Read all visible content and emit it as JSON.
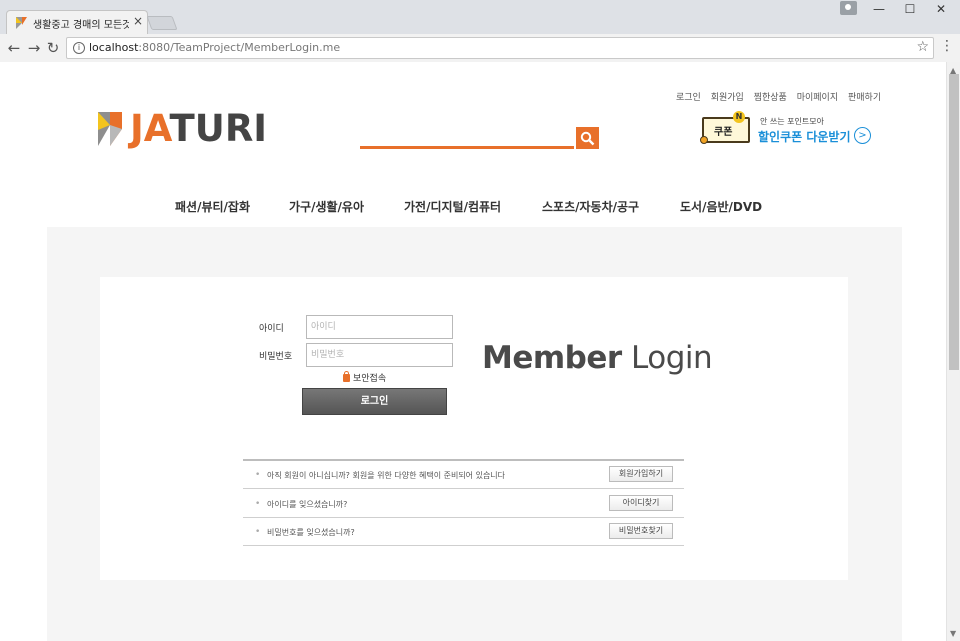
{
  "browser": {
    "tab_title": "생활중고 경매의 모든것",
    "tab_close": "×",
    "url_host": "localhost",
    "url_rest": ":8080/TeamProject/MemberLogin.me",
    "back": "←",
    "forward": "→",
    "reload": "↻",
    "info": "i",
    "star": "☆",
    "menu": "⋮",
    "minimize": "—",
    "maximize": "☐",
    "close": "✕"
  },
  "header": {
    "logo_prefix": "JA",
    "logo_suffix": "TURI",
    "util_links": [
      "로그인",
      "회원가입",
      "찜한상품",
      "마이페이지",
      "판매하기"
    ],
    "coupon": {
      "ticket": "쿠폰",
      "badge": "N",
      "small_text": "안 쓰는 포인트모아",
      "big_text": "할인쿠폰 다운받기",
      "arrow": ">"
    }
  },
  "gnb": [
    "패션/뷰티/잡화",
    "가구/생활/유아",
    "가전/디지털/컴퓨터",
    "스포츠/자동차/공구",
    "도서/음반/DVD"
  ],
  "login": {
    "id_label": "아이디",
    "id_placeholder": "아이디",
    "pw_label": "비밀번호",
    "pw_placeholder": "비밀번호",
    "secure_label": "보안접속",
    "login_button": "로그인",
    "title_bold": "Member",
    "title_light": "Login"
  },
  "help": [
    {
      "text": "아직 회원이 아니십니까?  회원을 위한 다양한 혜택이 준비되어 있습니다",
      "button": "회원가입하기"
    },
    {
      "text": "아이디를 잊으셨습니까?",
      "button": "아이디찾기"
    },
    {
      "text": "비밀번호를 잊으셨습니까?",
      "button": "비밀번호찾기"
    }
  ],
  "colors": {
    "accent": "#e8702a",
    "coupon_blue": "#1a8fd8"
  }
}
